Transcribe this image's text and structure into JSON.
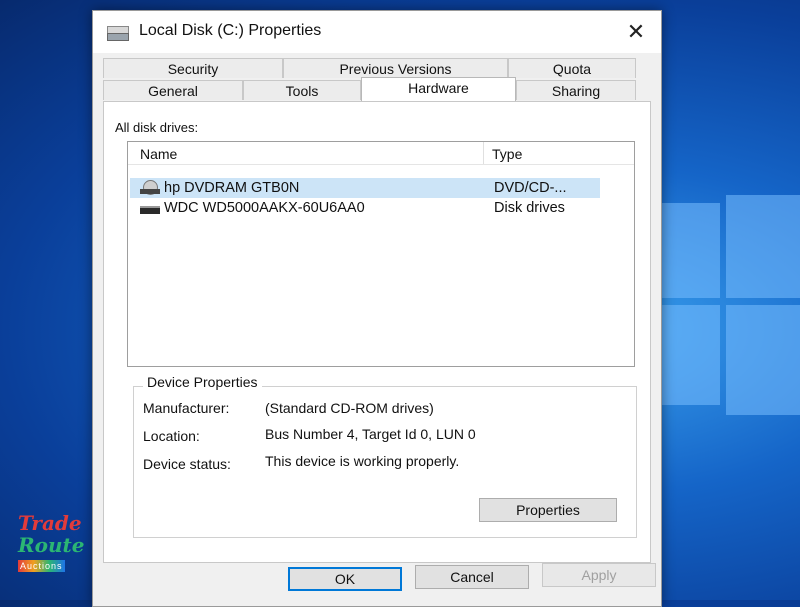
{
  "window": {
    "title": "Local Disk (C:) Properties",
    "close_glyph": "✕"
  },
  "tabs": {
    "row1": [
      "Security",
      "Previous Versions",
      "Quota"
    ],
    "row2": [
      "General",
      "Tools",
      "Hardware",
      "Sharing"
    ],
    "active": "Hardware"
  },
  "hardware": {
    "section_label": "All disk drives:",
    "columns": {
      "name": "Name",
      "type": "Type"
    },
    "drives": [
      {
        "name": "hp DVDRAM GTB0N",
        "type": "DVD/CD-...",
        "icon": "dvd-drive-icon",
        "selected": true
      },
      {
        "name": "WDC WD5000AAKX-60U6AA0",
        "type": "Disk drives",
        "icon": "hard-disk-icon",
        "selected": false
      }
    ],
    "device_properties": {
      "title": "Device Properties",
      "manufacturer_label": "Manufacturer:",
      "manufacturer_value": "(Standard CD-ROM drives)",
      "location_label": "Location:",
      "location_value": "Bus Number 4, Target Id 0, LUN 0",
      "status_label": "Device status:",
      "status_value": "This device is working properly.",
      "properties_button": "Properties"
    }
  },
  "buttons": {
    "ok": "OK",
    "cancel": "Cancel",
    "apply": "Apply"
  },
  "watermark": {
    "line1": "Trade",
    "line2": "Route",
    "line3": "Auctions"
  },
  "colors": {
    "accent": "#0078d7",
    "selection": "#cce4f7",
    "desktop": "#1565c8"
  }
}
